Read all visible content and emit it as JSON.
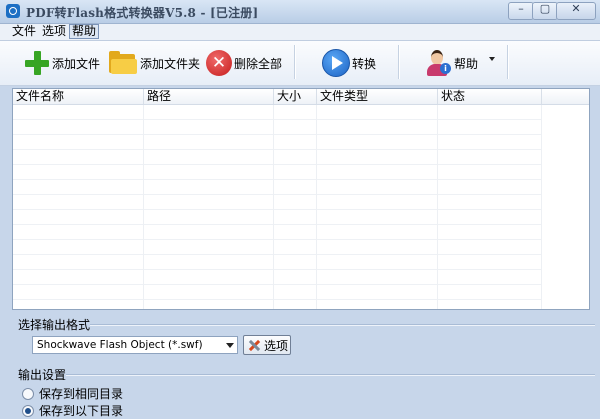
{
  "window": {
    "title": "PDF转Flash格式转换器V5.8  -  [已注册]",
    "controls": {
      "minimize": "–",
      "maximize": "▢",
      "close": "✕"
    }
  },
  "menu": {
    "items": [
      "文件",
      "选项",
      "帮助"
    ],
    "active_index": 2
  },
  "toolbar": {
    "add_file": "添加文件",
    "add_folder": "添加文件夹",
    "delete_all": "删除全部",
    "convert": "转换",
    "help": "帮助",
    "icons": {
      "add_file": "plus-icon",
      "add_folder": "folder-icon",
      "delete_all": "delete-x-icon",
      "convert": "play-icon",
      "help": "user-help-icon"
    }
  },
  "file_list": {
    "columns": [
      "文件名称",
      "路径",
      "大小",
      "文件类型",
      "状态"
    ],
    "rows": []
  },
  "output_format": {
    "label": "选择输出格式",
    "selected": "Shockwave Flash Object (*.swf)",
    "options_button": "选项"
  },
  "output_settings": {
    "label": "输出设置",
    "options": [
      {
        "label": "保存到相同目录",
        "selected": false
      },
      {
        "label": "保存到以下目录",
        "selected": true
      }
    ]
  },
  "colors": {
    "window_bg": "#c7d6ea",
    "accent_blue": "#1c63c4",
    "green_plus": "#37a524",
    "red_x": "#c51b1b"
  }
}
